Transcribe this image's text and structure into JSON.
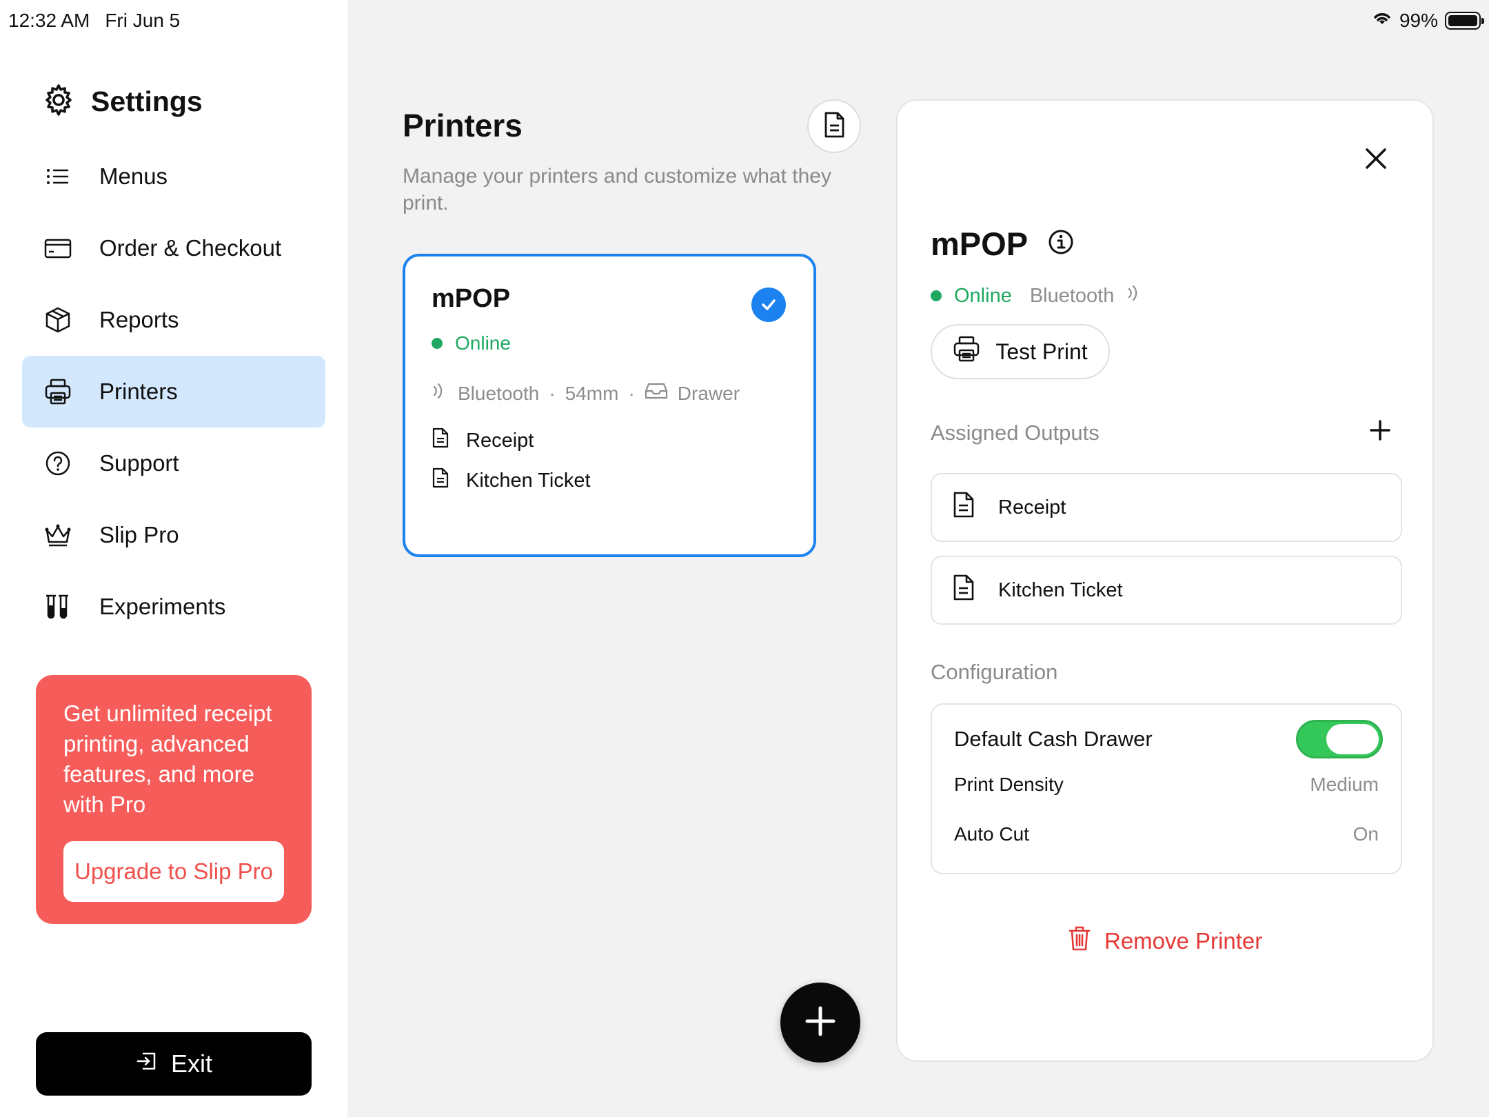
{
  "status_bar": {
    "time": "12:32 AM",
    "date": "Fri Jun 5",
    "battery": "99%",
    "battery_level": 0.99
  },
  "sidebar": {
    "title": "Settings",
    "items": [
      {
        "label": "Menus",
        "icon": "list-icon"
      },
      {
        "label": "Order & Checkout",
        "icon": "card-icon"
      },
      {
        "label": "Reports",
        "icon": "box-icon"
      },
      {
        "label": "Printers",
        "icon": "printer-icon",
        "active": true
      },
      {
        "label": "Support",
        "icon": "question-circle-icon"
      },
      {
        "label": "Slip Pro",
        "icon": "crown-icon"
      },
      {
        "label": "Experiments",
        "icon": "test-tubes-icon"
      }
    ],
    "promo": {
      "text": "Get unlimited receipt printing, advanced features, and more with Pro",
      "button": "Upgrade to Slip Pro"
    },
    "exit_label": "Exit"
  },
  "main": {
    "title": "Printers",
    "subtitle": "Manage your printers and customize what they print.",
    "printer_card": {
      "name": "mPOP",
      "status": "Online",
      "connection": "Bluetooth",
      "paper": "54mm",
      "separator": "·",
      "drawer": "Drawer",
      "outputs": [
        "Receipt",
        "Kitchen Ticket"
      ]
    }
  },
  "detail": {
    "name": "mPOP",
    "status": "Online",
    "connection": "Bluetooth",
    "test_print": "Test Print",
    "assigned_outputs_label": "Assigned Outputs",
    "outputs": [
      "Receipt",
      "Kitchen Ticket"
    ],
    "configuration_label": "Configuration",
    "config": {
      "cash_drawer_label": "Default Cash Drawer",
      "cash_drawer_on": true,
      "density_label": "Print Density",
      "density_value": "Medium",
      "autocut_label": "Auto Cut",
      "autocut_value": "On"
    },
    "remove_label": "Remove Printer"
  },
  "colors": {
    "accent": "#1b82f0",
    "active_nav": "#d3e7fd",
    "online": "#1fa861",
    "promo": "#f65d5a",
    "toggle_on": "#34c759",
    "danger": "#e53935"
  }
}
